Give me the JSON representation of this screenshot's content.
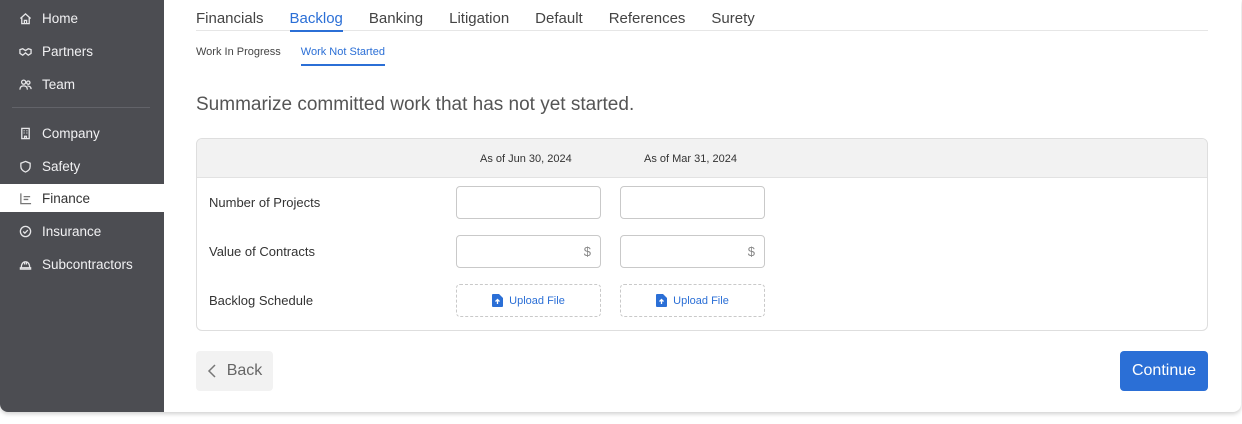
{
  "sidebar": {
    "items": [
      {
        "label": "Home",
        "icon": "home-icon"
      },
      {
        "label": "Partners",
        "icon": "handshake-icon"
      },
      {
        "label": "Team",
        "icon": "team-icon"
      },
      {
        "label": "Company",
        "icon": "building-icon"
      },
      {
        "label": "Safety",
        "icon": "shield-icon"
      },
      {
        "label": "Finance",
        "icon": "chart-icon",
        "active": true
      },
      {
        "label": "Insurance",
        "icon": "check-circle-icon"
      },
      {
        "label": "Subcontractors",
        "icon": "hardhat-icon"
      }
    ]
  },
  "tabs": [
    "Financials",
    "Backlog",
    "Banking",
    "Litigation",
    "Default",
    "References",
    "Surety"
  ],
  "active_tab": "Backlog",
  "subtabs": [
    "Work In Progress",
    "Work Not Started"
  ],
  "active_subtab": "Work Not Started",
  "heading": "Summarize committed work that has not yet started.",
  "table": {
    "columns": [
      "As of Jun 30, 2024",
      "As of Mar 31, 2024"
    ],
    "rows": {
      "projects": "Number of Projects",
      "contracts": "Value of Contracts",
      "schedule": "Backlog Schedule"
    },
    "currency_suffix": "$",
    "upload_label": "Upload File"
  },
  "buttons": {
    "back": "Back",
    "continue": "Continue"
  },
  "colors": {
    "accent": "#2b6fd6",
    "sidebar": "#4c4d52"
  }
}
